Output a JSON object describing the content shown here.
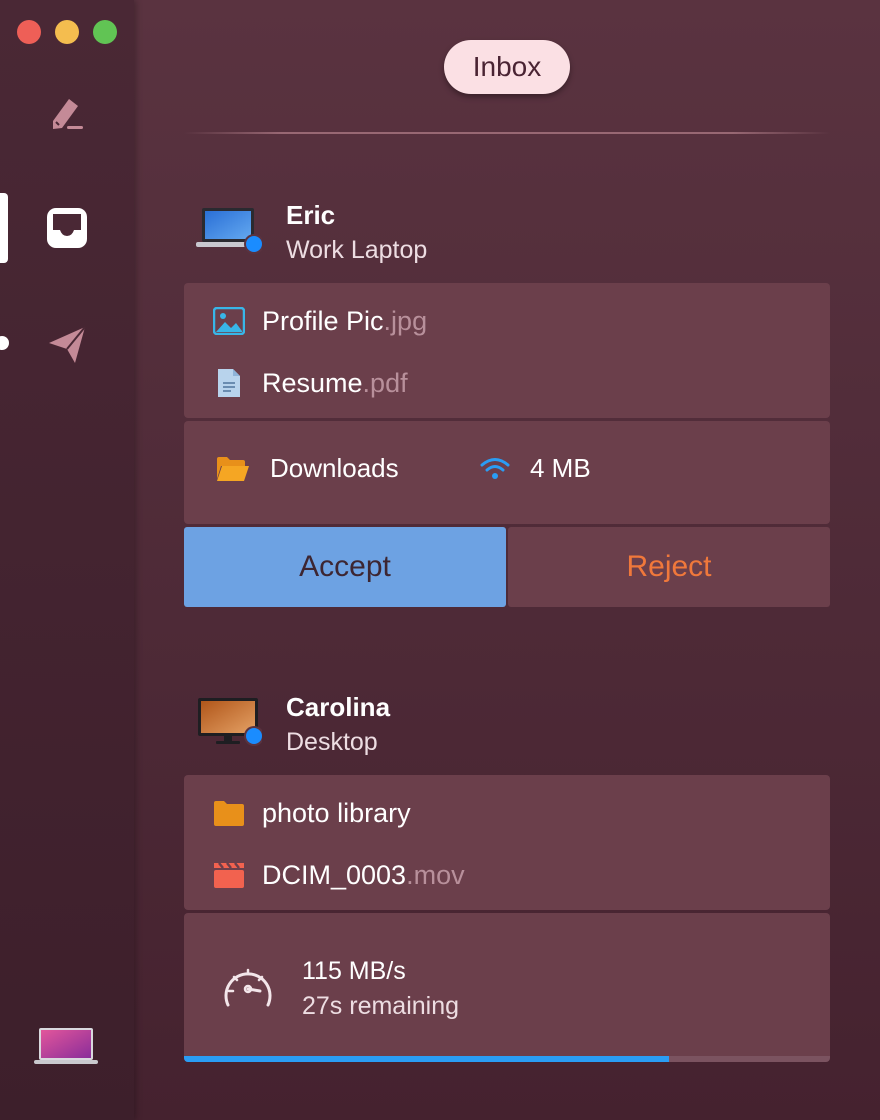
{
  "sidebar": {
    "nav": [
      {
        "id": "compose",
        "icon": "compose-icon"
      },
      {
        "id": "inbox",
        "icon": "inbox-tray-icon",
        "active": true
      },
      {
        "id": "send",
        "icon": "paper-plane-icon"
      }
    ],
    "this_device_icon": "laptop-icon"
  },
  "header": {
    "title": "Inbox"
  },
  "transfers": [
    {
      "sender": {
        "name": "Eric",
        "device": "Work Laptop",
        "device_icon": "laptop-icon"
      },
      "files": [
        {
          "name": "Profile Pic",
          "ext": ".jpg",
          "icon": "image-file-icon"
        },
        {
          "name": "Resume",
          "ext": ".pdf",
          "icon": "document-file-icon"
        }
      ],
      "destination": "Downloads",
      "size": "4 MB",
      "connection_icon": "wifi-icon",
      "accept_label": "Accept",
      "reject_label": "Reject"
    },
    {
      "sender": {
        "name": "Carolina",
        "device": "Desktop",
        "device_icon": "desktop-monitor-icon"
      },
      "files": [
        {
          "name": "photo library",
          "ext": "",
          "icon": "folder-icon"
        },
        {
          "name": "DCIM_0003",
          "ext": ".mov",
          "icon": "video-clapper-icon"
        }
      ],
      "speed": "115 MB/s",
      "remaining": "27s remaining",
      "speed_icon": "speedometer-icon",
      "progress": 0.75
    }
  ],
  "colors": {
    "accent_blue": "#6da2e3",
    "reject_orange": "#f0783b",
    "progress_blue": "#2a9df4",
    "folder_orange": "#e8901a",
    "online_dot": "#1a8cff"
  }
}
